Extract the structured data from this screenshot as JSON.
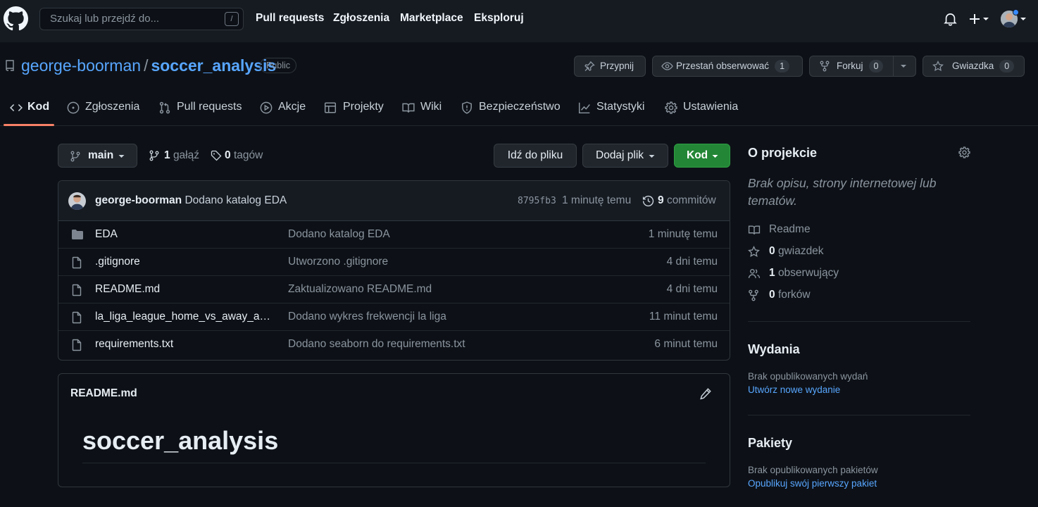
{
  "header": {
    "search_placeholder": "Szukaj lub przejdź do...",
    "search_shortcut": "/",
    "nav": [
      "Pull requests",
      "Zgłoszenia",
      "Marketplace",
      "Eksploruj"
    ]
  },
  "repo": {
    "owner": "george-boorman",
    "separator": "/",
    "name": "soccer_analysis",
    "visibility": "Public",
    "pin_label": "Przypnij",
    "unwatch_label": "Przestań obserwować",
    "watch_count": "1",
    "fork_label": "Forkuj",
    "fork_count": "0",
    "star_label": "Gwiazdka",
    "star_count": "0"
  },
  "tabs": [
    "Kod",
    "Zgłoszenia",
    "Pull requests",
    "Akcje",
    "Projekty",
    "Wiki",
    "Bezpieczeństwo",
    "Statystyki",
    "Ustawienia"
  ],
  "toolbar": {
    "branch": "main",
    "branch_count": "1",
    "branch_label": "gałąź",
    "tag_count": "0",
    "tag_label": "tagów",
    "goto_file": "Idź do pliku",
    "add_file": "Dodaj plik",
    "code": "Kod"
  },
  "commit": {
    "author": "george-boorman",
    "message": "Dodano katalog EDA",
    "sha": "8795fb3",
    "time": "1 minutę temu",
    "commit_count": "9",
    "commit_label": "commitów"
  },
  "files": [
    {
      "type": "folder",
      "name": "EDA",
      "message": "Dodano katalog EDA",
      "time": "1 minutę temu"
    },
    {
      "type": "file",
      "name": ".gitignore",
      "message": "Utworzono .gitignore",
      "time": "4 dni temu"
    },
    {
      "type": "file",
      "name": "README.md",
      "message": "Zaktualizowano README.md",
      "time": "4 dni temu"
    },
    {
      "type": "file",
      "name": "la_liga_league_home_vs_away_att…",
      "message": "Dodano wykres frekwencji la liga",
      "time": "11 minut temu"
    },
    {
      "type": "file",
      "name": "requirements.txt",
      "message": "Dodano seaborn do requirements.txt",
      "time": "6 minut temu"
    }
  ],
  "readme": {
    "filename": "README.md",
    "heading": "soccer_analysis"
  },
  "sidebar": {
    "about_title": "O projekcie",
    "about_desc": "Brak opisu, strony internetowej lub tematów.",
    "readme_label": "Readme",
    "stars_count": "0",
    "stars_label": "gwiazdek",
    "watchers_count": "1",
    "watchers_label": "obserwujący",
    "forks_count": "0",
    "forks_label": "forków",
    "releases_title": "Wydania",
    "releases_empty": "Brak opublikowanych wydań",
    "releases_link": "Utwórz nowe wydanie",
    "packages_title": "Pakiety",
    "packages_empty": "Brak opublikowanych pakietów",
    "packages_link": "Opublikuj swój pierwszy pakiet"
  }
}
